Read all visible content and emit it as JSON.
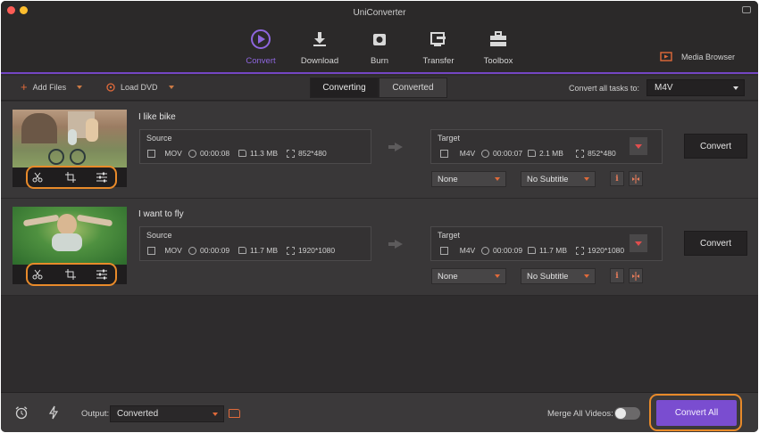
{
  "window": {
    "title": "UniConverter"
  },
  "toolbar": {
    "items": [
      {
        "label": "Convert",
        "icon": "convert-icon",
        "active": true
      },
      {
        "label": "Download",
        "icon": "download-icon"
      },
      {
        "label": "Burn",
        "icon": "burn-icon"
      },
      {
        "label": "Transfer",
        "icon": "transfer-icon"
      },
      {
        "label": "Toolbox",
        "icon": "toolbox-icon"
      }
    ],
    "media_browser": "Media Browser"
  },
  "subbar": {
    "add_files": "Add Files",
    "load_dvd": "Load DVD",
    "tabs": [
      "Converting",
      "Converted"
    ],
    "active_tab": "Converting",
    "convert_all_label": "Convert all tasks to:",
    "convert_all_format": "M4V"
  },
  "tasks": [
    {
      "title": "I like bike",
      "source": {
        "label": "Source",
        "format": "MOV",
        "duration": "00:00:08",
        "size": "11.3 MB",
        "resolution": "852*480"
      },
      "target": {
        "label": "Target",
        "format": "M4V",
        "duration": "00:00:07",
        "size": "2.1 MB",
        "resolution": "852*480"
      },
      "audio": "None",
      "subtitle": "No Subtitle",
      "convert_label": "Convert"
    },
    {
      "title": "I want to fly",
      "source": {
        "label": "Source",
        "format": "MOV",
        "duration": "00:00:09",
        "size": "11.7 MB",
        "resolution": "1920*1080"
      },
      "target": {
        "label": "Target",
        "format": "M4V",
        "duration": "00:00:09",
        "size": "11.7 MB",
        "resolution": "1920*1080"
      },
      "audio": "None",
      "subtitle": "No Subtitle",
      "convert_label": "Convert"
    }
  ],
  "bottom": {
    "output_label": "Output:",
    "output_value": "Converted",
    "merge_label": "Merge All Videos:",
    "merge_enabled": false,
    "convert_all": "Convert All"
  },
  "colors": {
    "accent": "#7a4dd0",
    "highlight": "#e88a2a",
    "background": "#2e2c2d"
  }
}
